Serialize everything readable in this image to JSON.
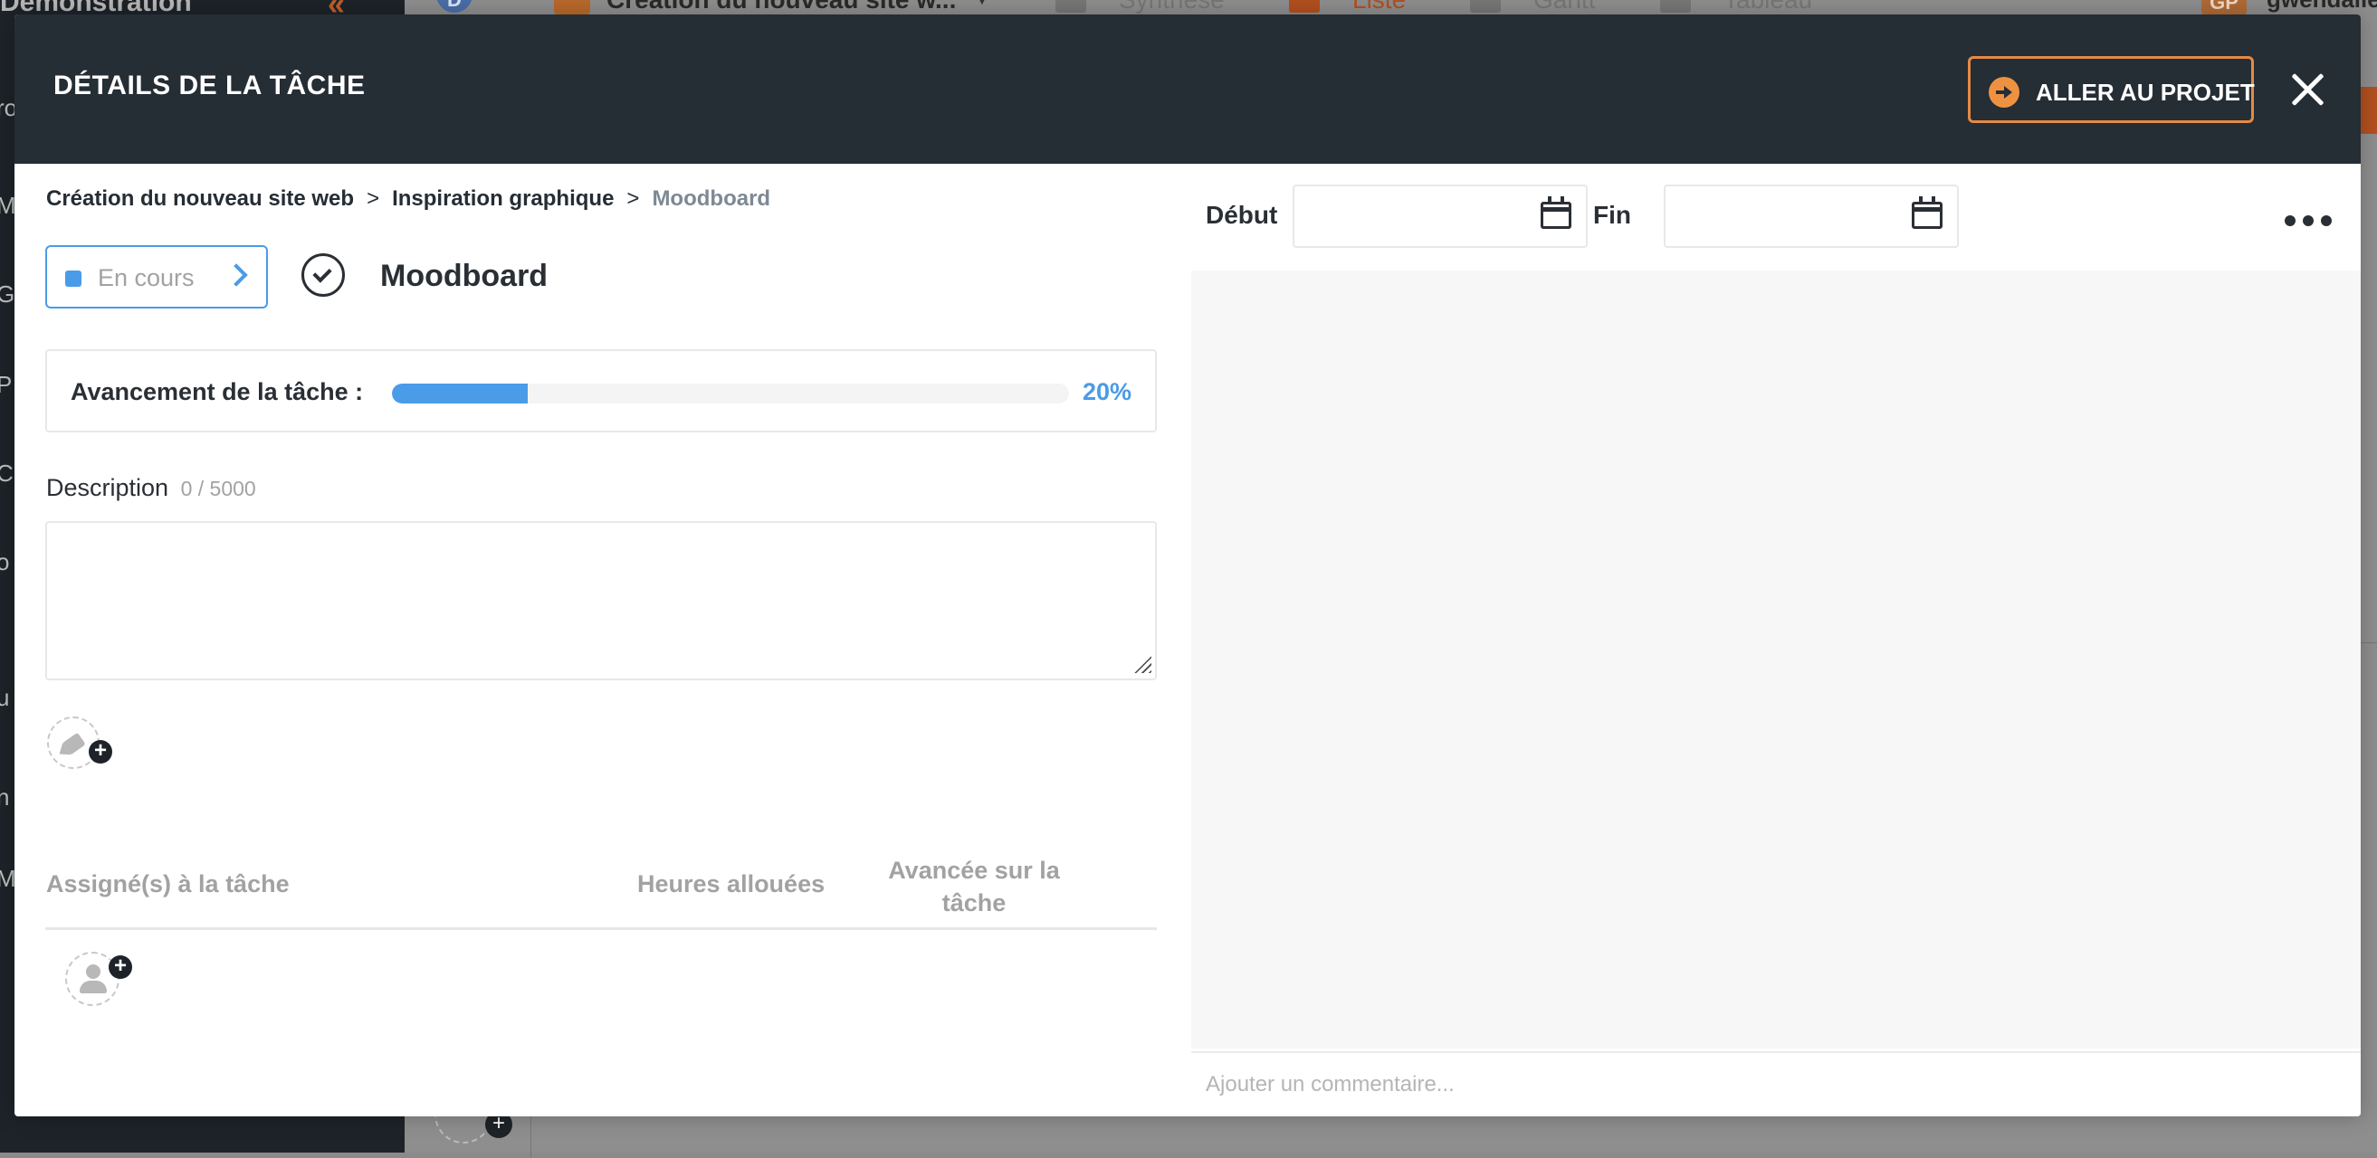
{
  "background": {
    "workspace_title": "Démonstration",
    "workspace_avatar": "D",
    "project_name": "Création du nouveau site w...",
    "tabs": [
      {
        "label": "Synthèse",
        "active": false
      },
      {
        "label": "Liste",
        "active": true
      },
      {
        "label": "Gantt",
        "active": false
      },
      {
        "label": "Tableau",
        "active": false
      }
    ],
    "user_initials": "GP",
    "user_name": "gwendalle"
  },
  "modal": {
    "title": "DÉTAILS DE LA TÂCHE",
    "goto_project_label": "ALLER AU PROJET",
    "breadcrumb": {
      "items": [
        "Création du nouveau site web",
        "Inspiration graphique"
      ],
      "separator": ">",
      "current": "Moodboard"
    },
    "status": {
      "label": "En cours",
      "color": "#4a9be8"
    },
    "task_name": "Moodboard",
    "progress": {
      "label": "Avancement de la tâche :",
      "value": 20,
      "display": "20%"
    },
    "description": {
      "label": "Description",
      "count": "0 / 5000",
      "value": ""
    },
    "assignees_table": {
      "columns": [
        "Assigné(s) à la tâche",
        "Heures allouées",
        "Avancée sur la tâche"
      ]
    },
    "dates": {
      "start_label": "Début",
      "start_value": "",
      "end_label": "Fin",
      "end_value": ""
    },
    "comment_placeholder": "Ajouter un commentaire..."
  },
  "colors": {
    "header_bg": "#252d35",
    "accent_orange": "#ee9242",
    "accent_blue": "#4a9be8"
  },
  "icons": [
    "arrow-right-circle-icon",
    "close-icon",
    "chevron-right-icon",
    "check-circle-icon",
    "tag-icon",
    "plus-icon",
    "user-icon",
    "calendar-icon",
    "more-icon"
  ]
}
